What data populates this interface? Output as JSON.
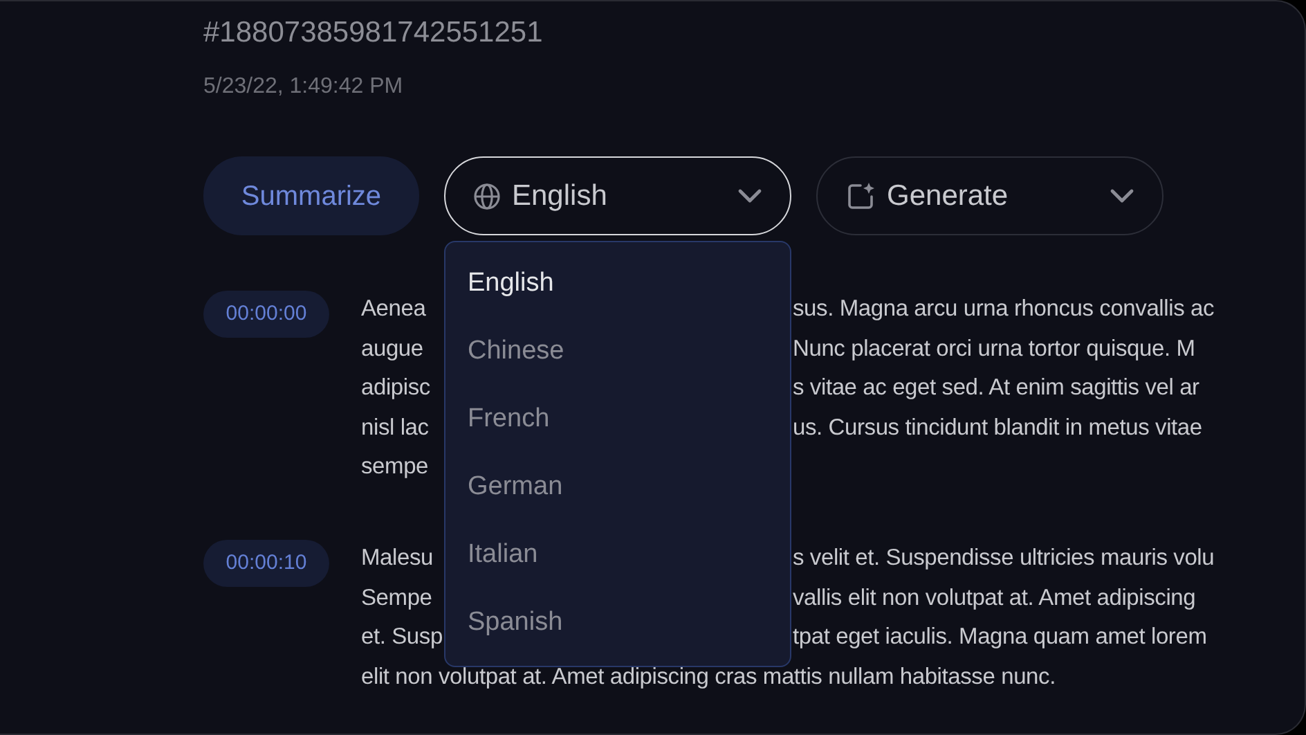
{
  "record": {
    "id": "#18807385981742551251",
    "timestamp": "5/23/22, 1:49:42 PM"
  },
  "toolbar": {
    "summarize": "Summarize",
    "language_select": {
      "value": "English",
      "expanded": true
    },
    "generate_select": {
      "value": "Generate"
    }
  },
  "language_menu": [
    {
      "label": "English",
      "selected": true
    },
    {
      "label": "Chinese",
      "selected": false
    },
    {
      "label": "French",
      "selected": false
    },
    {
      "label": "German",
      "selected": false
    },
    {
      "label": "Italian",
      "selected": false
    },
    {
      "label": "Spanish",
      "selected": false
    }
  ],
  "transcript": [
    {
      "time": "00:00:00",
      "lines": [
        {
          "left": "Aenea",
          "right": "sus. Magna arcu urna rhoncus convallis ac"
        },
        {
          "left": "augue",
          "right": "Nunc placerat orci urna tortor quisque. M"
        },
        {
          "left": "adipisc",
          "right": "s vitae ac eget sed. At enim sagittis vel ar"
        },
        {
          "left": "nisl lac",
          "right": "us. Cursus tincidunt blandit in metus vitae"
        },
        {
          "left": "sempe"
        }
      ]
    },
    {
      "time": "00:00:10",
      "lines": [
        {
          "left": "Malesu",
          "right": "s velit et. Suspendisse ultricies mauris volu"
        },
        {
          "left": "Sempe",
          "right": "vallis elit non volutpat at. Amet adipiscing"
        },
        {
          "left": "et. Susp",
          "right": "tpat eget iaculis. Magna quam amet lorem"
        },
        {
          "left": "elit non volutpat at. Amet adipiscing cras mattis nullam habitasse nunc."
        }
      ]
    }
  ]
}
